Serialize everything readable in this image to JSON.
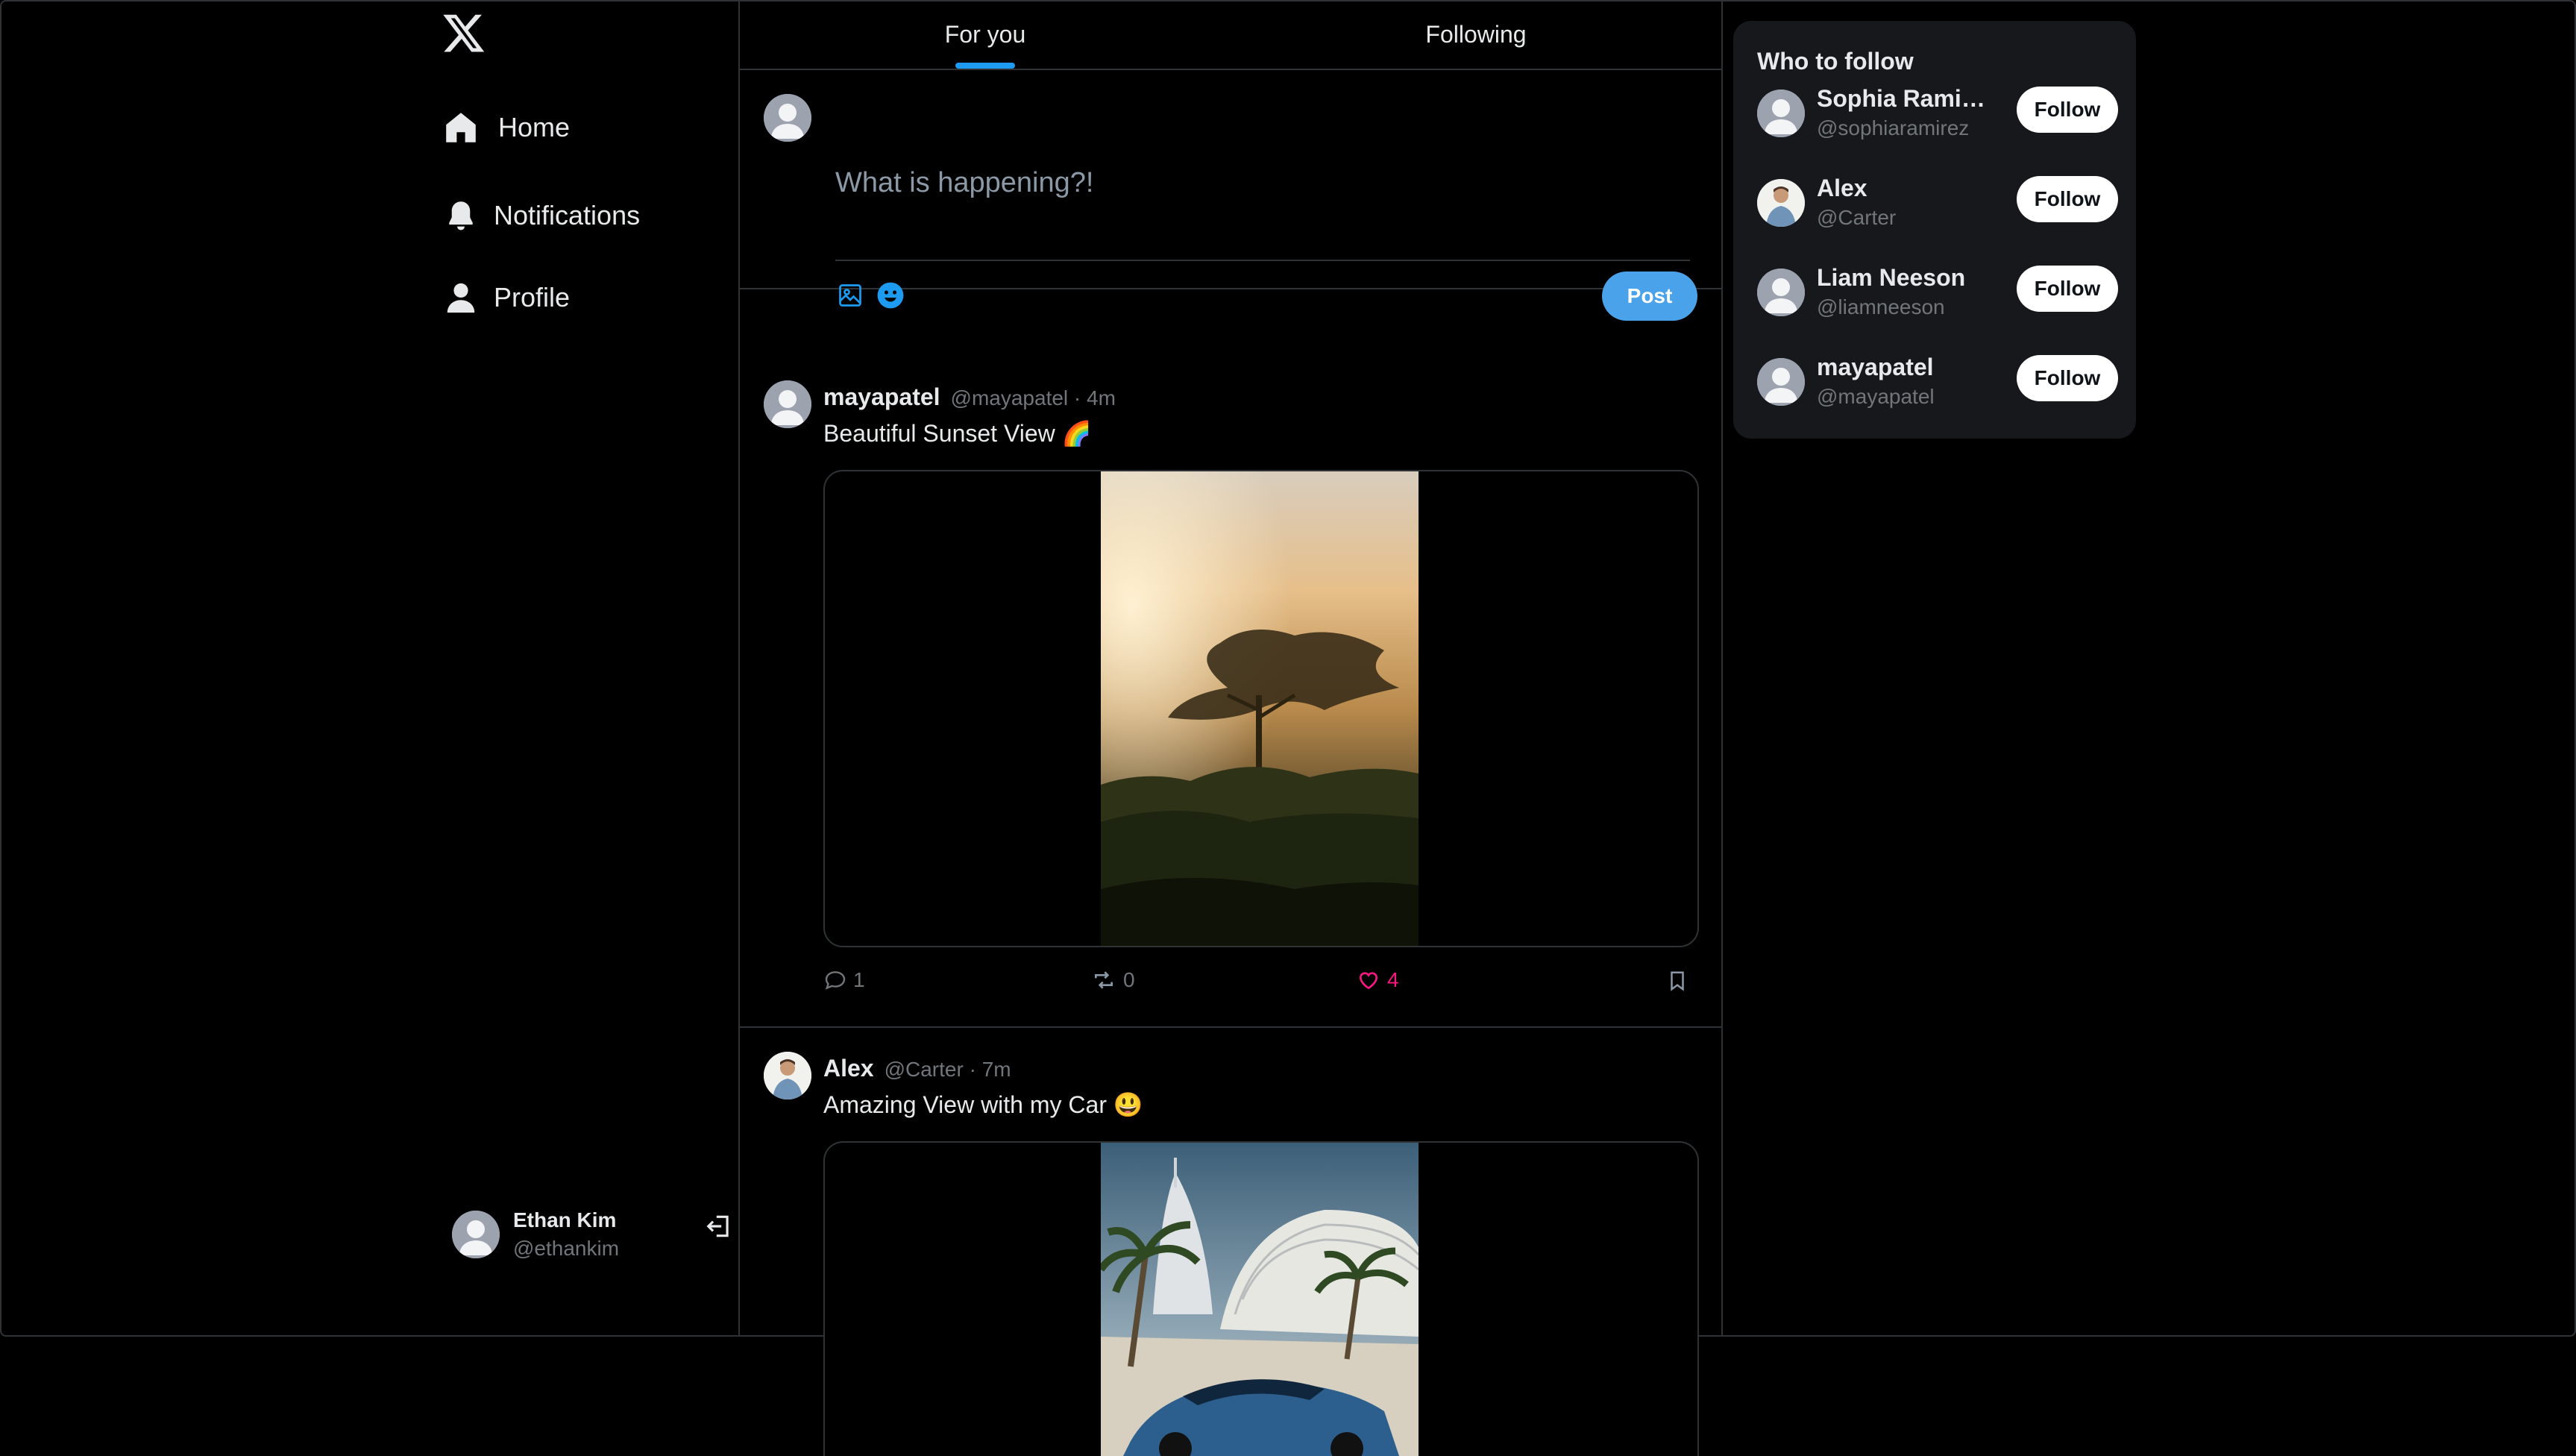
{
  "sidebar": {
    "logo": "x-logo-icon",
    "items": [
      {
        "label": "Home",
        "icon": "home-icon"
      },
      {
        "label": "Notifications",
        "icon": "bell-icon"
      },
      {
        "label": "Profile",
        "icon": "user-icon"
      }
    ],
    "account": {
      "name": "Ethan Kim",
      "handle": "@ethankim",
      "action_icon": "logout-icon"
    }
  },
  "tabs": [
    {
      "label": "For you",
      "active": true
    },
    {
      "label": "Following",
      "active": false
    }
  ],
  "composer": {
    "placeholder": "What is happening?!",
    "tools": [
      "image-icon",
      "emoji-icon"
    ],
    "post_label": "Post"
  },
  "posts": [
    {
      "name": "mayapatel",
      "meta": "@mayapatel · 4m",
      "text": "Beautiful Sunset View 🌈",
      "media": "acacia tree in golden sunset mist",
      "replies": "1",
      "reposts": "0",
      "likes": "4"
    },
    {
      "name": "Alex",
      "meta": "@Carter · 7m",
      "text": "Amazing View with my Car 😃",
      "media": "blue sports car in front of palm trees and hotel towers"
    }
  ],
  "who_to_follow": {
    "title": "Who to follow",
    "follow_label": "Follow",
    "users": [
      {
        "name": "Sophia Ramir...",
        "handle": "@sophiaramirez"
      },
      {
        "name": "Alex",
        "handle": "@Carter"
      },
      {
        "name": "Liam Neeson",
        "handle": "@liamneeson"
      },
      {
        "name": "mayapatel",
        "handle": "@mayapatel"
      }
    ]
  },
  "colors": {
    "background": "#000000",
    "border": "#2f3336",
    "accent": "#1d9bf0",
    "post_button": "#4aa3ea",
    "like": "#f91880",
    "muted": "#71767b",
    "card": "#16181c"
  }
}
